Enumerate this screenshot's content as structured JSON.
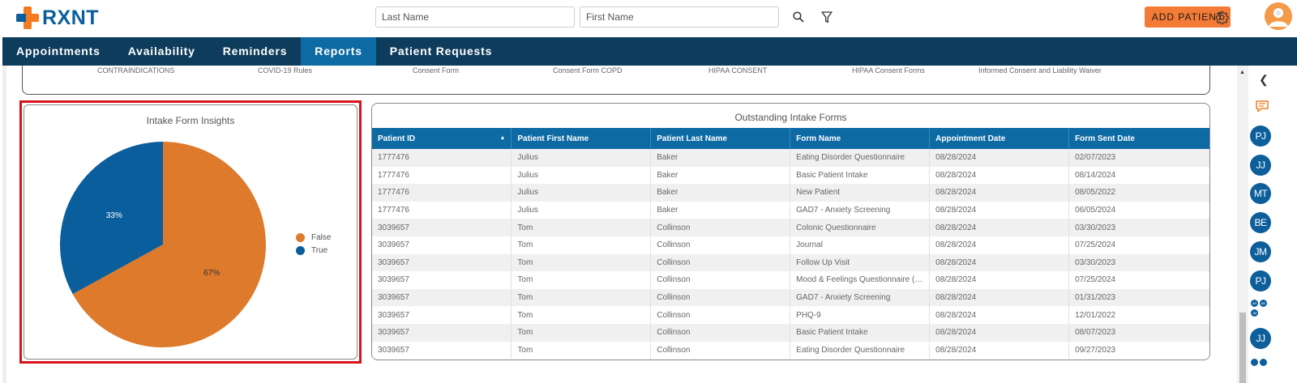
{
  "header": {
    "logo_text": "RXNT",
    "last_name_placeholder": "Last Name",
    "first_name_placeholder": "First Name",
    "add_patient_label": "ADD PATIENT"
  },
  "nav": {
    "items": [
      {
        "label": "Appointments"
      },
      {
        "label": "Availability"
      },
      {
        "label": "Reminders"
      },
      {
        "label": "Reports"
      },
      {
        "label": "Patient Requests"
      }
    ],
    "active": "Reports"
  },
  "consent_forms": [
    "CONTRAINDICATIONS",
    "COVID-19 Rules",
    "Consent Form",
    "Consent Form COPD",
    "HIPAA CONSENT",
    "HIPAA Consent Forms",
    "Informed Consent and Liability Waiver"
  ],
  "insights": {
    "title": "Intake Form Insights",
    "legend": [
      {
        "label": "False",
        "color": "#dd7a2b"
      },
      {
        "label": "True",
        "color": "#0b5e9c"
      }
    ]
  },
  "chart_data": {
    "type": "pie",
    "title": "Intake Form Insights",
    "categories": [
      "False",
      "True"
    ],
    "values": [
      67,
      33
    ],
    "labels": [
      "67%",
      "33%"
    ],
    "colors": [
      "#dd7a2b",
      "#0b5e9c"
    ],
    "legend": "right"
  },
  "outstanding": {
    "title": "Outstanding Intake Forms",
    "columns": [
      "Patient ID",
      "Patient First Name",
      "Patient Last Name",
      "Form Name",
      "Appointment Date",
      "Form Sent Date"
    ],
    "rows": [
      [
        "1777476",
        "Julius",
        "Baker",
        "Eating Disorder Questionnaire",
        "08/28/2024",
        "02/07/2023"
      ],
      [
        "1777476",
        "Julius",
        "Baker",
        "Basic Patient Intake",
        "08/28/2024",
        "08/14/2024"
      ],
      [
        "1777476",
        "Julius",
        "Baker",
        "New Patient",
        "08/28/2024",
        "08/05/2022"
      ],
      [
        "1777476",
        "Julius",
        "Baker",
        "GAD7 - Anxiety Screening",
        "08/28/2024",
        "06/05/2024"
      ],
      [
        "3039657",
        "Tom",
        "Collinson",
        "Colonic Questionnaire",
        "08/28/2024",
        "03/30/2023"
      ],
      [
        "3039657",
        "Tom",
        "Collinson",
        "Journal",
        "08/28/2024",
        "07/25/2024"
      ],
      [
        "3039657",
        "Tom",
        "Collinson",
        "Follow Up Visit",
        "08/28/2024",
        "03/30/2023"
      ],
      [
        "3039657",
        "Tom",
        "Collinson",
        "Mood & Feelings Questionnaire (MFQ...",
        "08/28/2024",
        "07/25/2024"
      ],
      [
        "3039657",
        "Tom",
        "Collinson",
        "GAD7 - Anxiety Screening",
        "08/28/2024",
        "01/31/2023"
      ],
      [
        "3039657",
        "Tom",
        "Collinson",
        "PHQ-9",
        "08/28/2024",
        "12/01/2022"
      ],
      [
        "3039657",
        "Tom",
        "Collinson",
        "Basic Patient Intake",
        "08/28/2024",
        "08/07/2023"
      ],
      [
        "3039657",
        "Tom",
        "Collinson",
        "Eating Disorder Questionnaire",
        "08/28/2024",
        "09/27/2023"
      ]
    ]
  },
  "sidebar": {
    "chat_icon": "chat-bubble-icon",
    "bubbles": [
      "PJ",
      "JJ",
      "MT",
      "BE",
      "JM",
      "PJ"
    ],
    "mini_bubbles": [
      "AR",
      "BE",
      "JM"
    ],
    "last_bubble": "JJ"
  }
}
